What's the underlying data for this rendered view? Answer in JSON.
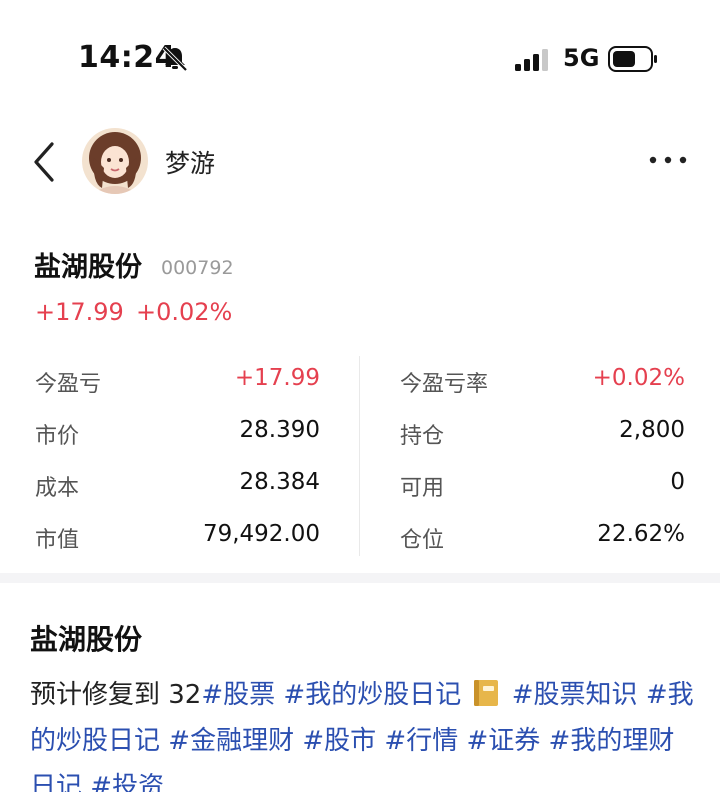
{
  "status_bar": {
    "time": "14:24",
    "network": "5G",
    "icons": [
      "bell-muted-icon",
      "signal-icon",
      "battery-icon"
    ]
  },
  "header": {
    "username": "梦游",
    "icons": [
      "back-icon",
      "avatar",
      "more-icon"
    ]
  },
  "stock": {
    "name": "盐湖股份",
    "code": "000792",
    "change_abs": "+17.99",
    "change_pct": "+0.02%"
  },
  "stats": {
    "rows": [
      {
        "left_label": "今盈亏",
        "left_value": "+17.99",
        "right_label": "今盈亏率",
        "right_value": "+0.02%"
      },
      {
        "left_label": "市价",
        "left_value": "28.390",
        "right_label": "持仓",
        "right_value": "2,800"
      },
      {
        "left_label": "成本",
        "left_value": "28.384",
        "right_label": "可用",
        "right_value": "0"
      },
      {
        "left_label": "市值",
        "left_value": "79,492.00",
        "right_label": "仓位",
        "right_value": "22.62%"
      }
    ]
  },
  "post": {
    "title": "盐湖股份",
    "text_prefix": "预计修复到 32",
    "tags": [
      "#股票",
      "#我的炒股日记",
      "#股票知识",
      "#我的炒股日记",
      "#金融理财",
      "#股市",
      "#行情",
      "#证券",
      "#我的理财日记",
      "#投资"
    ],
    "emoji_icon": "notebook-icon"
  },
  "colors": {
    "up_red": "#e5404f",
    "tag_blue": "#2b4fb0",
    "label_gray": "#555555",
    "code_gray": "#9a9a9a"
  }
}
